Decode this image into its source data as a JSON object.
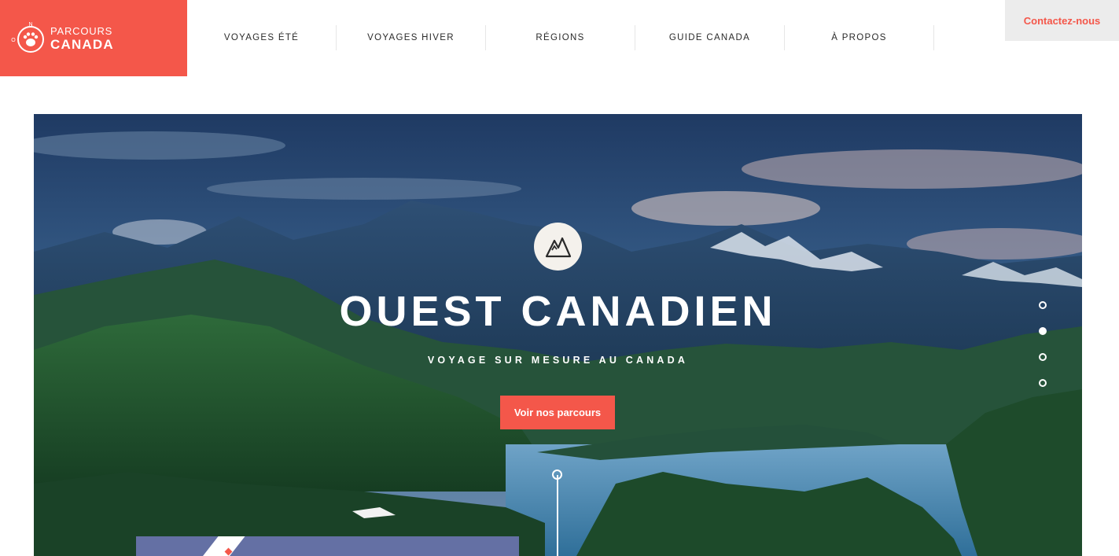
{
  "logo": {
    "line1": "PARCOURS",
    "line2": "CANADA",
    "compass_letter_n": "N",
    "compass_letter_o": "O",
    "icon": "paw-compass-icon"
  },
  "nav": {
    "items": [
      {
        "label": "VOYAGES ÉTÉ"
      },
      {
        "label": "VOYAGES HIVER"
      },
      {
        "label": "RÉGIONS"
      },
      {
        "label": "GUIDE CANADA"
      },
      {
        "label": "À PROPOS"
      }
    ]
  },
  "contact": {
    "label": "Contactez-nous"
  },
  "hero": {
    "title": "OUEST CANADIEN",
    "subtitle": "VOYAGE SUR MESURE AU CANADA",
    "cta": "Voir nos parcours",
    "badge_icon": "mountain-icon",
    "slides": {
      "count": 4,
      "active_index": 1
    }
  },
  "colors": {
    "brand": "#f4574a",
    "contact_bg": "#ececec",
    "sky": "#3b5e85",
    "forest": "#1f4a2a",
    "water": "#4a8ab0"
  }
}
